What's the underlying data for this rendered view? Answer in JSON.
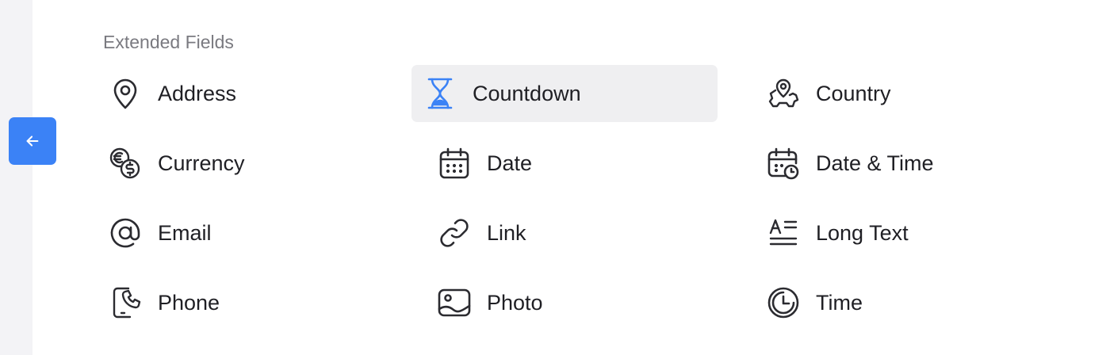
{
  "section": {
    "title": "Extended Fields"
  },
  "back_button": {
    "icon": "arrow-left-icon",
    "accent": "#3b82f6"
  },
  "fields": [
    {
      "label": "Address",
      "icon": "map-pin-icon",
      "selected": false
    },
    {
      "label": "Countdown",
      "icon": "hourglass-icon",
      "selected": true
    },
    {
      "label": "Country",
      "icon": "map-pin-country-icon",
      "selected": false
    },
    {
      "label": "Currency",
      "icon": "currency-icon",
      "selected": false
    },
    {
      "label": "Date",
      "icon": "calendar-icon",
      "selected": false
    },
    {
      "label": "Date & Time",
      "icon": "calendar-clock-icon",
      "selected": false
    },
    {
      "label": "Email",
      "icon": "at-sign-icon",
      "selected": false
    },
    {
      "label": "Link",
      "icon": "link-icon",
      "selected": false
    },
    {
      "label": "Long Text",
      "icon": "long-text-icon",
      "selected": false
    },
    {
      "label": "Phone",
      "icon": "phone-icon",
      "selected": false
    },
    {
      "label": "Photo",
      "icon": "photo-icon",
      "selected": false
    },
    {
      "label": "Time",
      "icon": "clock-icon",
      "selected": false
    }
  ]
}
